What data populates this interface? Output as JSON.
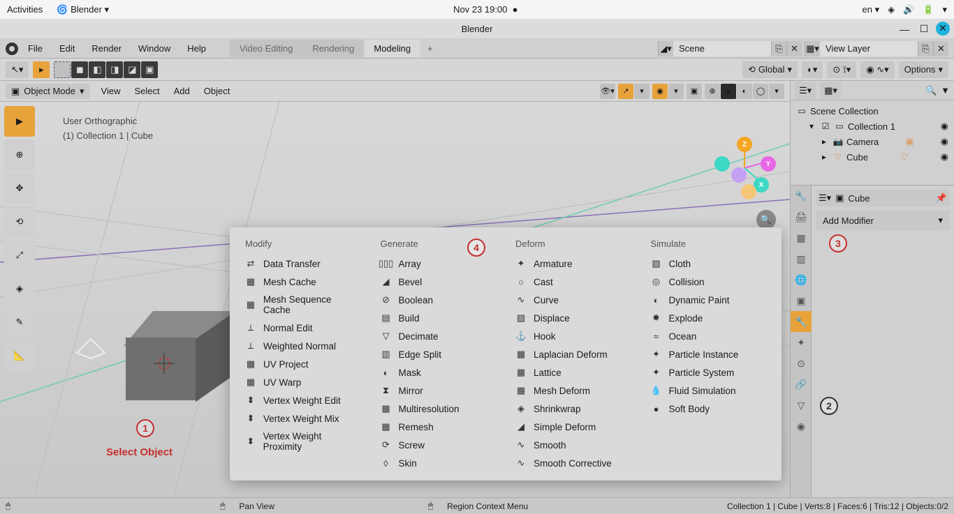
{
  "system": {
    "activities": "Activities",
    "app": "Blender",
    "datetime": "Nov 23  19:00",
    "lang": "en"
  },
  "window": {
    "title": "Blender"
  },
  "menu": {
    "file": "File",
    "edit": "Edit",
    "render": "Render",
    "window": "Window",
    "help": "Help"
  },
  "workspaces": {
    "video": "Video Editing",
    "rendering": "Rendering",
    "modeling": "Modeling"
  },
  "scene": {
    "scene_label": "Scene",
    "layer_label": "View Layer"
  },
  "toolbar": {
    "orientation": "Global",
    "options": "Options"
  },
  "viewport": {
    "mode": "Object Mode",
    "menus": {
      "view": "View",
      "select": "Select",
      "add": "Add",
      "object": "Object"
    },
    "overlay1": "User Orthographic",
    "overlay2": "(1) Collection 1 | Cube"
  },
  "annotations": {
    "n1": "1",
    "label1": "Select Object",
    "n2": "2",
    "n3": "3",
    "n4": "4"
  },
  "modifiers": {
    "cols": {
      "modify": "Modify",
      "generate": "Generate",
      "deform": "Deform",
      "simulate": "Simulate"
    },
    "modify": [
      "Data Transfer",
      "Mesh Cache",
      "Mesh Sequence Cache",
      "Normal Edit",
      "Weighted Normal",
      "UV Project",
      "UV Warp",
      "Vertex Weight Edit",
      "Vertex Weight Mix",
      "Vertex Weight Proximity"
    ],
    "generate": [
      "Array",
      "Bevel",
      "Boolean",
      "Build",
      "Decimate",
      "Edge Split",
      "Mask",
      "Mirror",
      "Multiresolution",
      "Remesh",
      "Screw",
      "Skin"
    ],
    "deform": [
      "Armature",
      "Cast",
      "Curve",
      "Displace",
      "Hook",
      "Laplacian Deform",
      "Lattice",
      "Mesh Deform",
      "Shrinkwrap",
      "Simple Deform",
      "Smooth",
      "Smooth Corrective"
    ],
    "simulate": [
      "Cloth",
      "Collision",
      "Dynamic Paint",
      "Explode",
      "Ocean",
      "Particle Instance",
      "Particle System",
      "Fluid Simulation",
      "Soft Body"
    ]
  },
  "outliner": {
    "scene_collection": "Scene Collection",
    "collection1": "Collection 1",
    "camera": "Camera",
    "cube": "Cube"
  },
  "properties": {
    "object": "Cube",
    "add_modifier": "Add Modifier"
  },
  "status": {
    "pan": "Pan View",
    "context": "Region Context Menu",
    "info": "Collection 1 | Cube | Verts:8 | Faces:6 | Tris:12 | Objects:0/2"
  }
}
